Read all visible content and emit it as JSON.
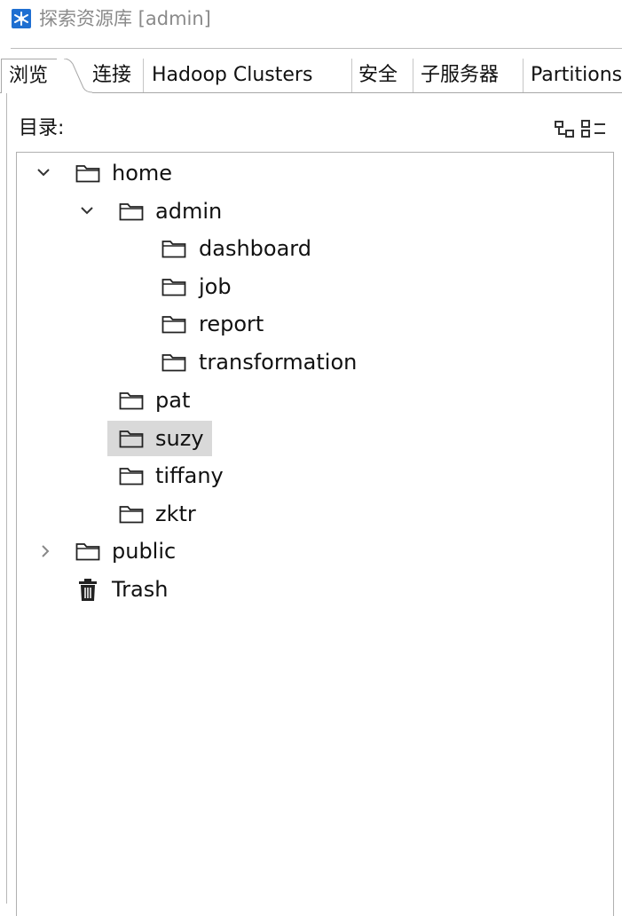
{
  "window": {
    "title": "探索资源库 [admin]",
    "icon": "repository-explorer-icon"
  },
  "tabs": [
    {
      "label": "浏览",
      "active": true
    },
    {
      "label": "连接",
      "active": false
    },
    {
      "label": "Hadoop Clusters",
      "active": false
    },
    {
      "label": "安全",
      "active": false
    },
    {
      "label": "子服务器",
      "active": false
    },
    {
      "label": "Partitions",
      "active": false
    }
  ],
  "panel": {
    "directory_label": "目录:",
    "view_icons": [
      "tree-view-icon",
      "list-view-icon"
    ]
  },
  "tree": {
    "home": {
      "label": "home",
      "expanded": true
    },
    "admin": {
      "label": "admin",
      "expanded": true
    },
    "dashboard": {
      "label": "dashboard"
    },
    "job": {
      "label": "job"
    },
    "report": {
      "label": "report"
    },
    "transformation": {
      "label": "transformation"
    },
    "pat": {
      "label": "pat"
    },
    "suzy": {
      "label": "suzy",
      "selected": true
    },
    "tiffany": {
      "label": "tiffany"
    },
    "zktr": {
      "label": "zktr"
    },
    "public": {
      "label": "public",
      "expanded": false
    },
    "trash": {
      "label": "Trash"
    }
  },
  "colors": {
    "accent": "#1f6fd1",
    "selection": "#d9d9d9",
    "border": "#b0b0b0",
    "title_text": "#8a8a8a"
  }
}
